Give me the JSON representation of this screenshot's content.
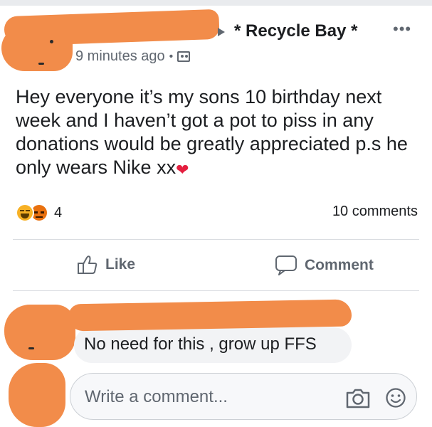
{
  "post": {
    "group_name": "* Recycle Bay *",
    "more_label": "•••",
    "time": "9 minutes ago",
    "separator": "•",
    "text": "Hey everyone it’s my sons 10 birthday next week and I haven’t got a pot to piss in any donations would be greatly appreciated p.s he only wears Nike  xx",
    "heart_emoji": "❤",
    "reactions": {
      "count": "4",
      "icons": [
        "haha-emoji",
        "angry-emoji"
      ]
    },
    "comments_count": "10 comments"
  },
  "actions": {
    "like_label": "Like",
    "comment_label": "Comment"
  },
  "comment": {
    "text": "No need for this , grow up FFS"
  },
  "composer": {
    "placeholder": "Write a comment..."
  },
  "colors": {
    "redaction": "#f28c4a",
    "text": "#1c1e21",
    "secondary": "#606770",
    "bubble": "#f2f3f5"
  }
}
